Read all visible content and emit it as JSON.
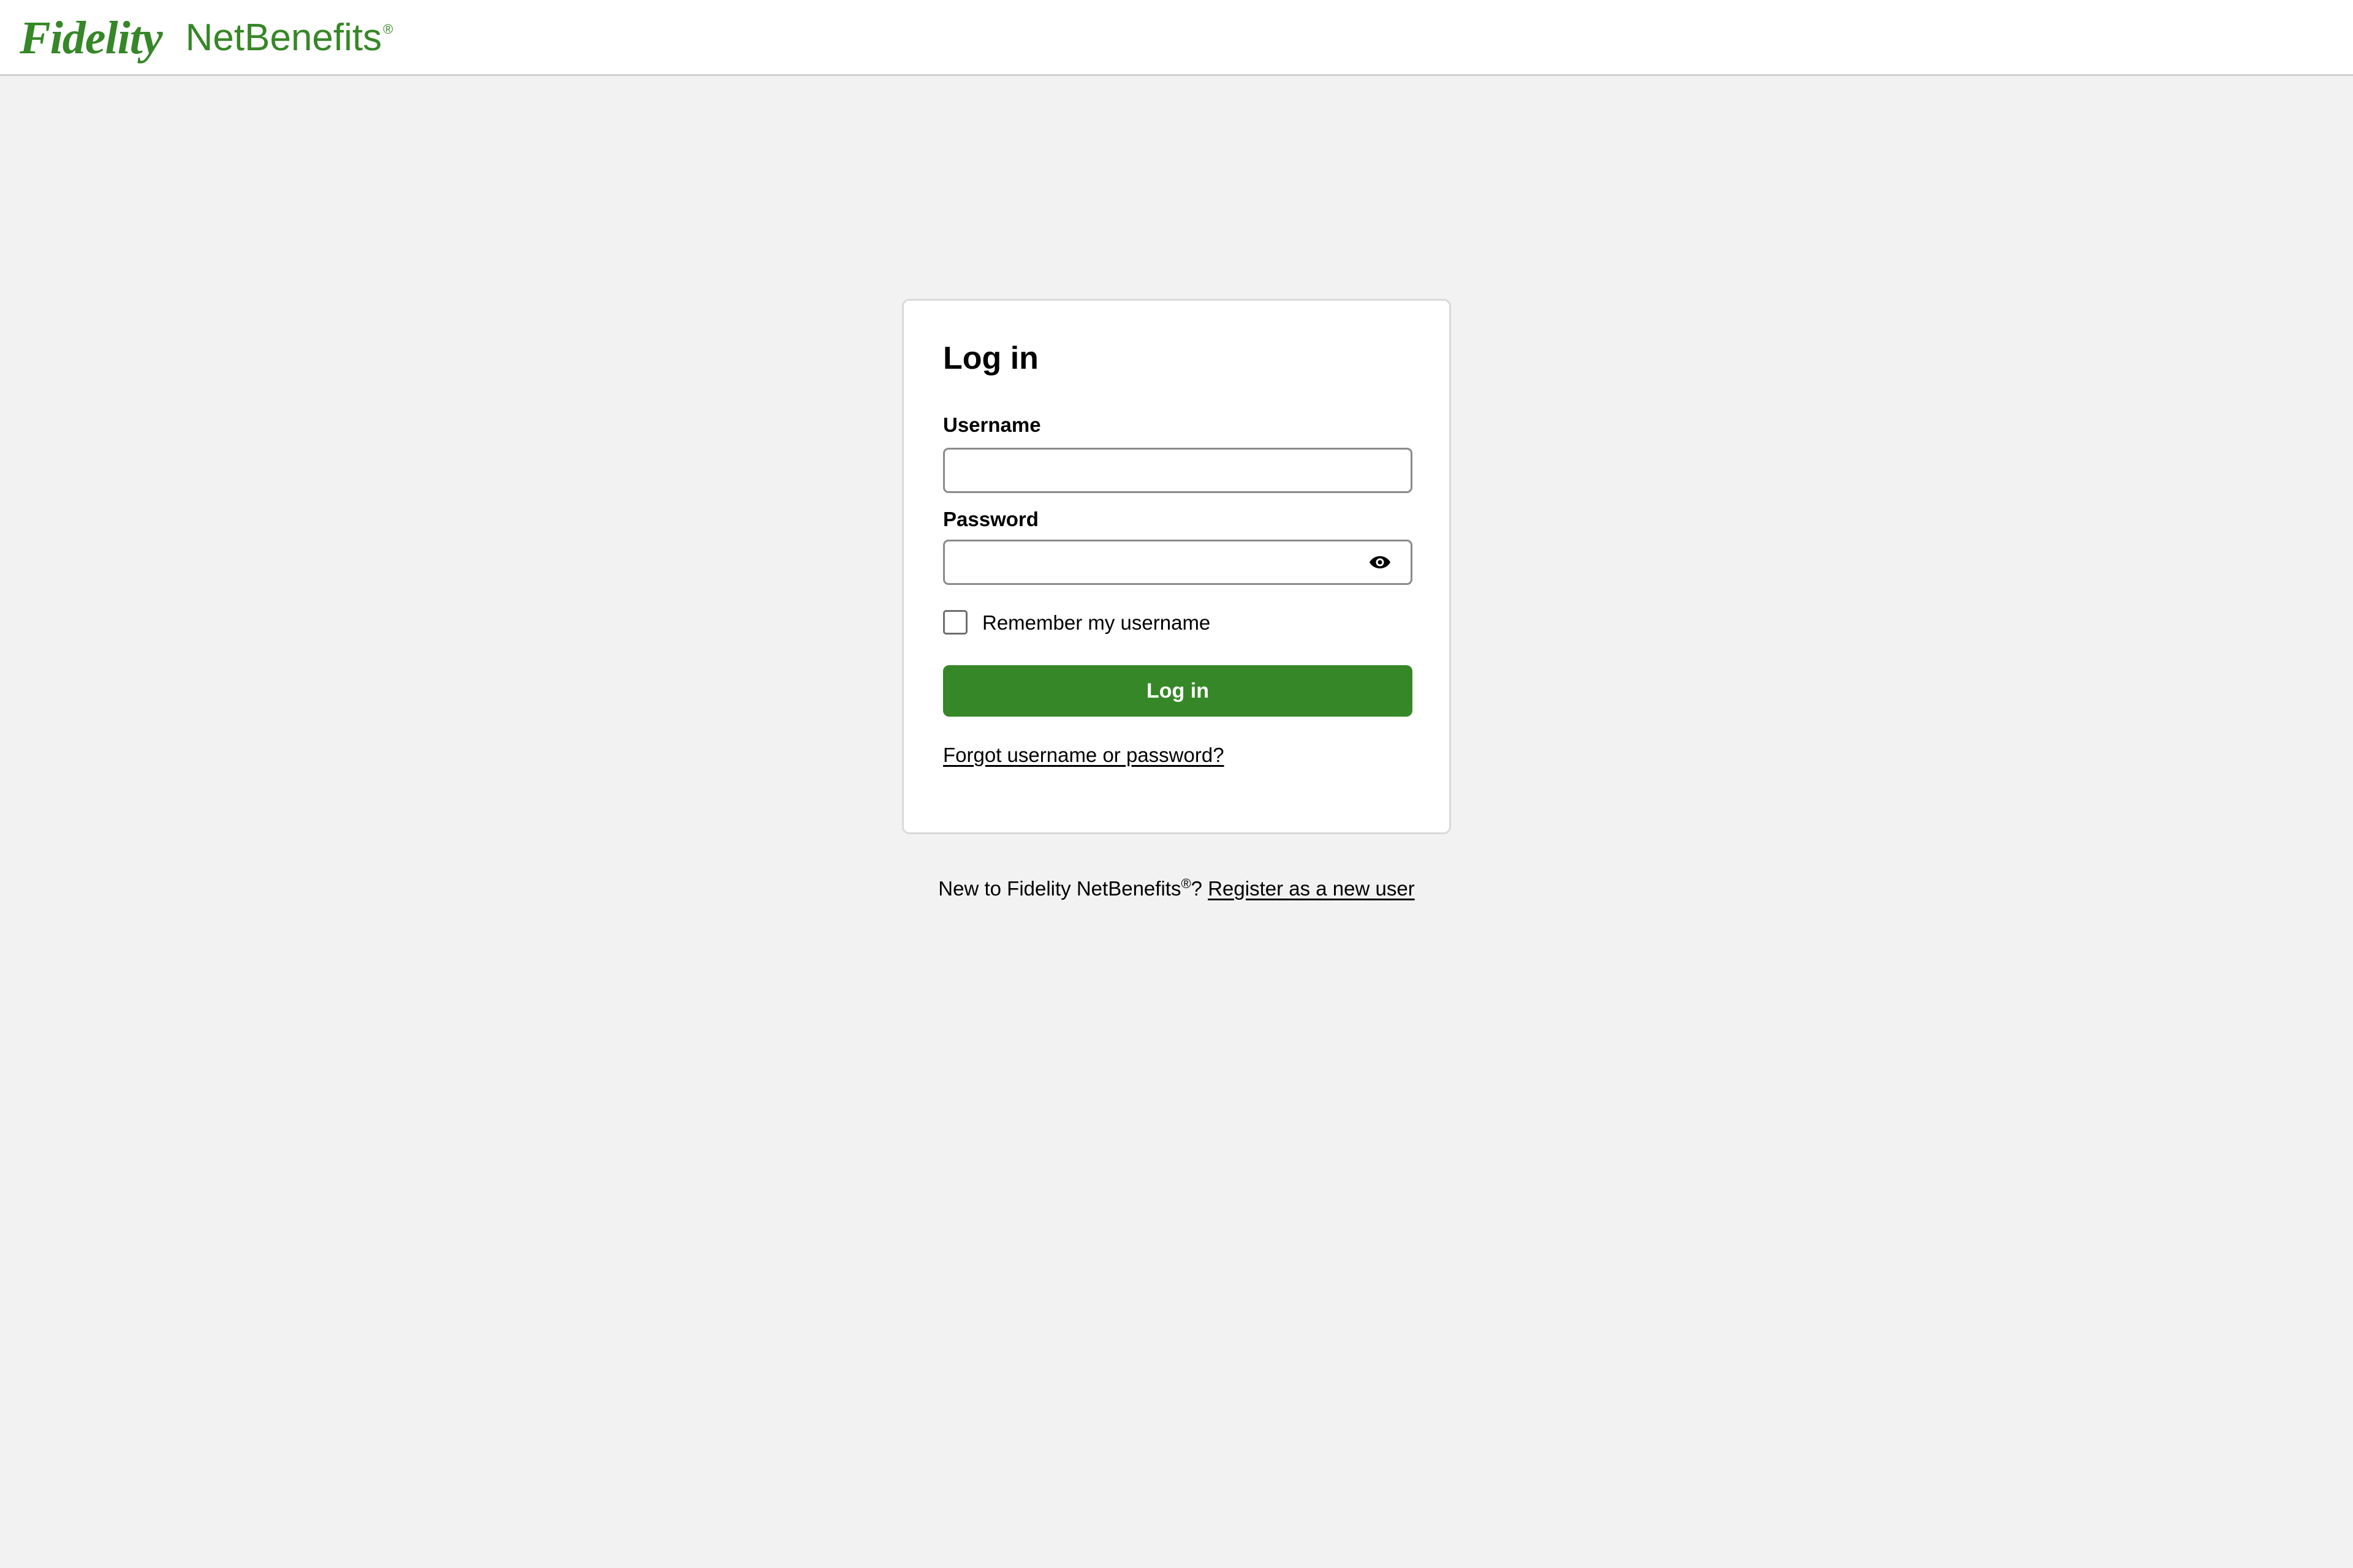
{
  "header": {
    "brand_name": "Fidelity",
    "product_name": "NetBenefits",
    "product_mark": "®"
  },
  "login": {
    "title": "Log in",
    "username_label": "Username",
    "username_value": "",
    "password_label": "Password",
    "password_value": "",
    "show_password_icon": "eye-icon",
    "remember_label": "Remember my username",
    "remember_checked": false,
    "submit_label": "Log in",
    "forgot_link": "Forgot username or password?"
  },
  "footer": {
    "new_user_prefix": "New to Fidelity NetBenefits",
    "new_user_mark": "®",
    "new_user_suffix": "?",
    "register_link": "Register as a new user"
  },
  "colors": {
    "brand_green": "#368727",
    "page_background": "#f2f2f2",
    "card_background": "#ffffff"
  }
}
